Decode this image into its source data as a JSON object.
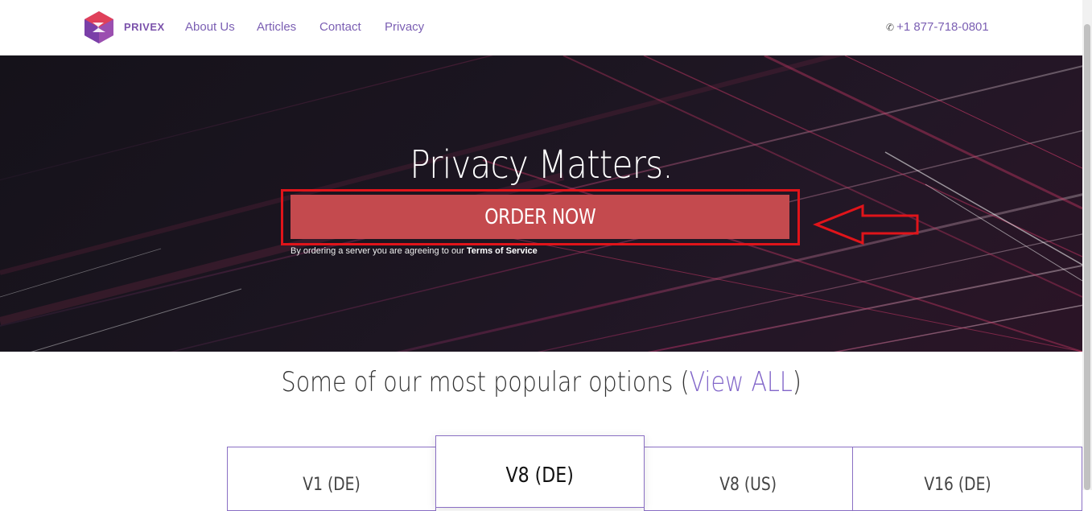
{
  "header": {
    "brand": "PRIVEX",
    "nav": [
      {
        "label": "About Us"
      },
      {
        "label": "Articles"
      },
      {
        "label": "Contact"
      },
      {
        "label": "Privacy"
      }
    ],
    "phone": "+1 877-718-0801"
  },
  "hero": {
    "title": "Privacy Matters.",
    "order_button": "ORDER NOW",
    "terms_text": "By ordering a server you are agreeing to our ",
    "terms_link": "Terms of Service"
  },
  "popular": {
    "heading": "Some of our most popular options (",
    "view_all": "View ALL",
    "heading_close": ")",
    "cards": [
      {
        "label": "V1 (DE)"
      },
      {
        "label": "V8 (DE)",
        "featured": true
      },
      {
        "label": "V8 (US)"
      },
      {
        "label": "V16 (DE)"
      }
    ]
  },
  "colors": {
    "accent": "#7b5fb3",
    "order_button": "#c44a4e",
    "annotation_red": "#e0141a"
  },
  "icons": [
    "privex-logo-icon",
    "phone-icon",
    "annotation-arrow-icon"
  ]
}
